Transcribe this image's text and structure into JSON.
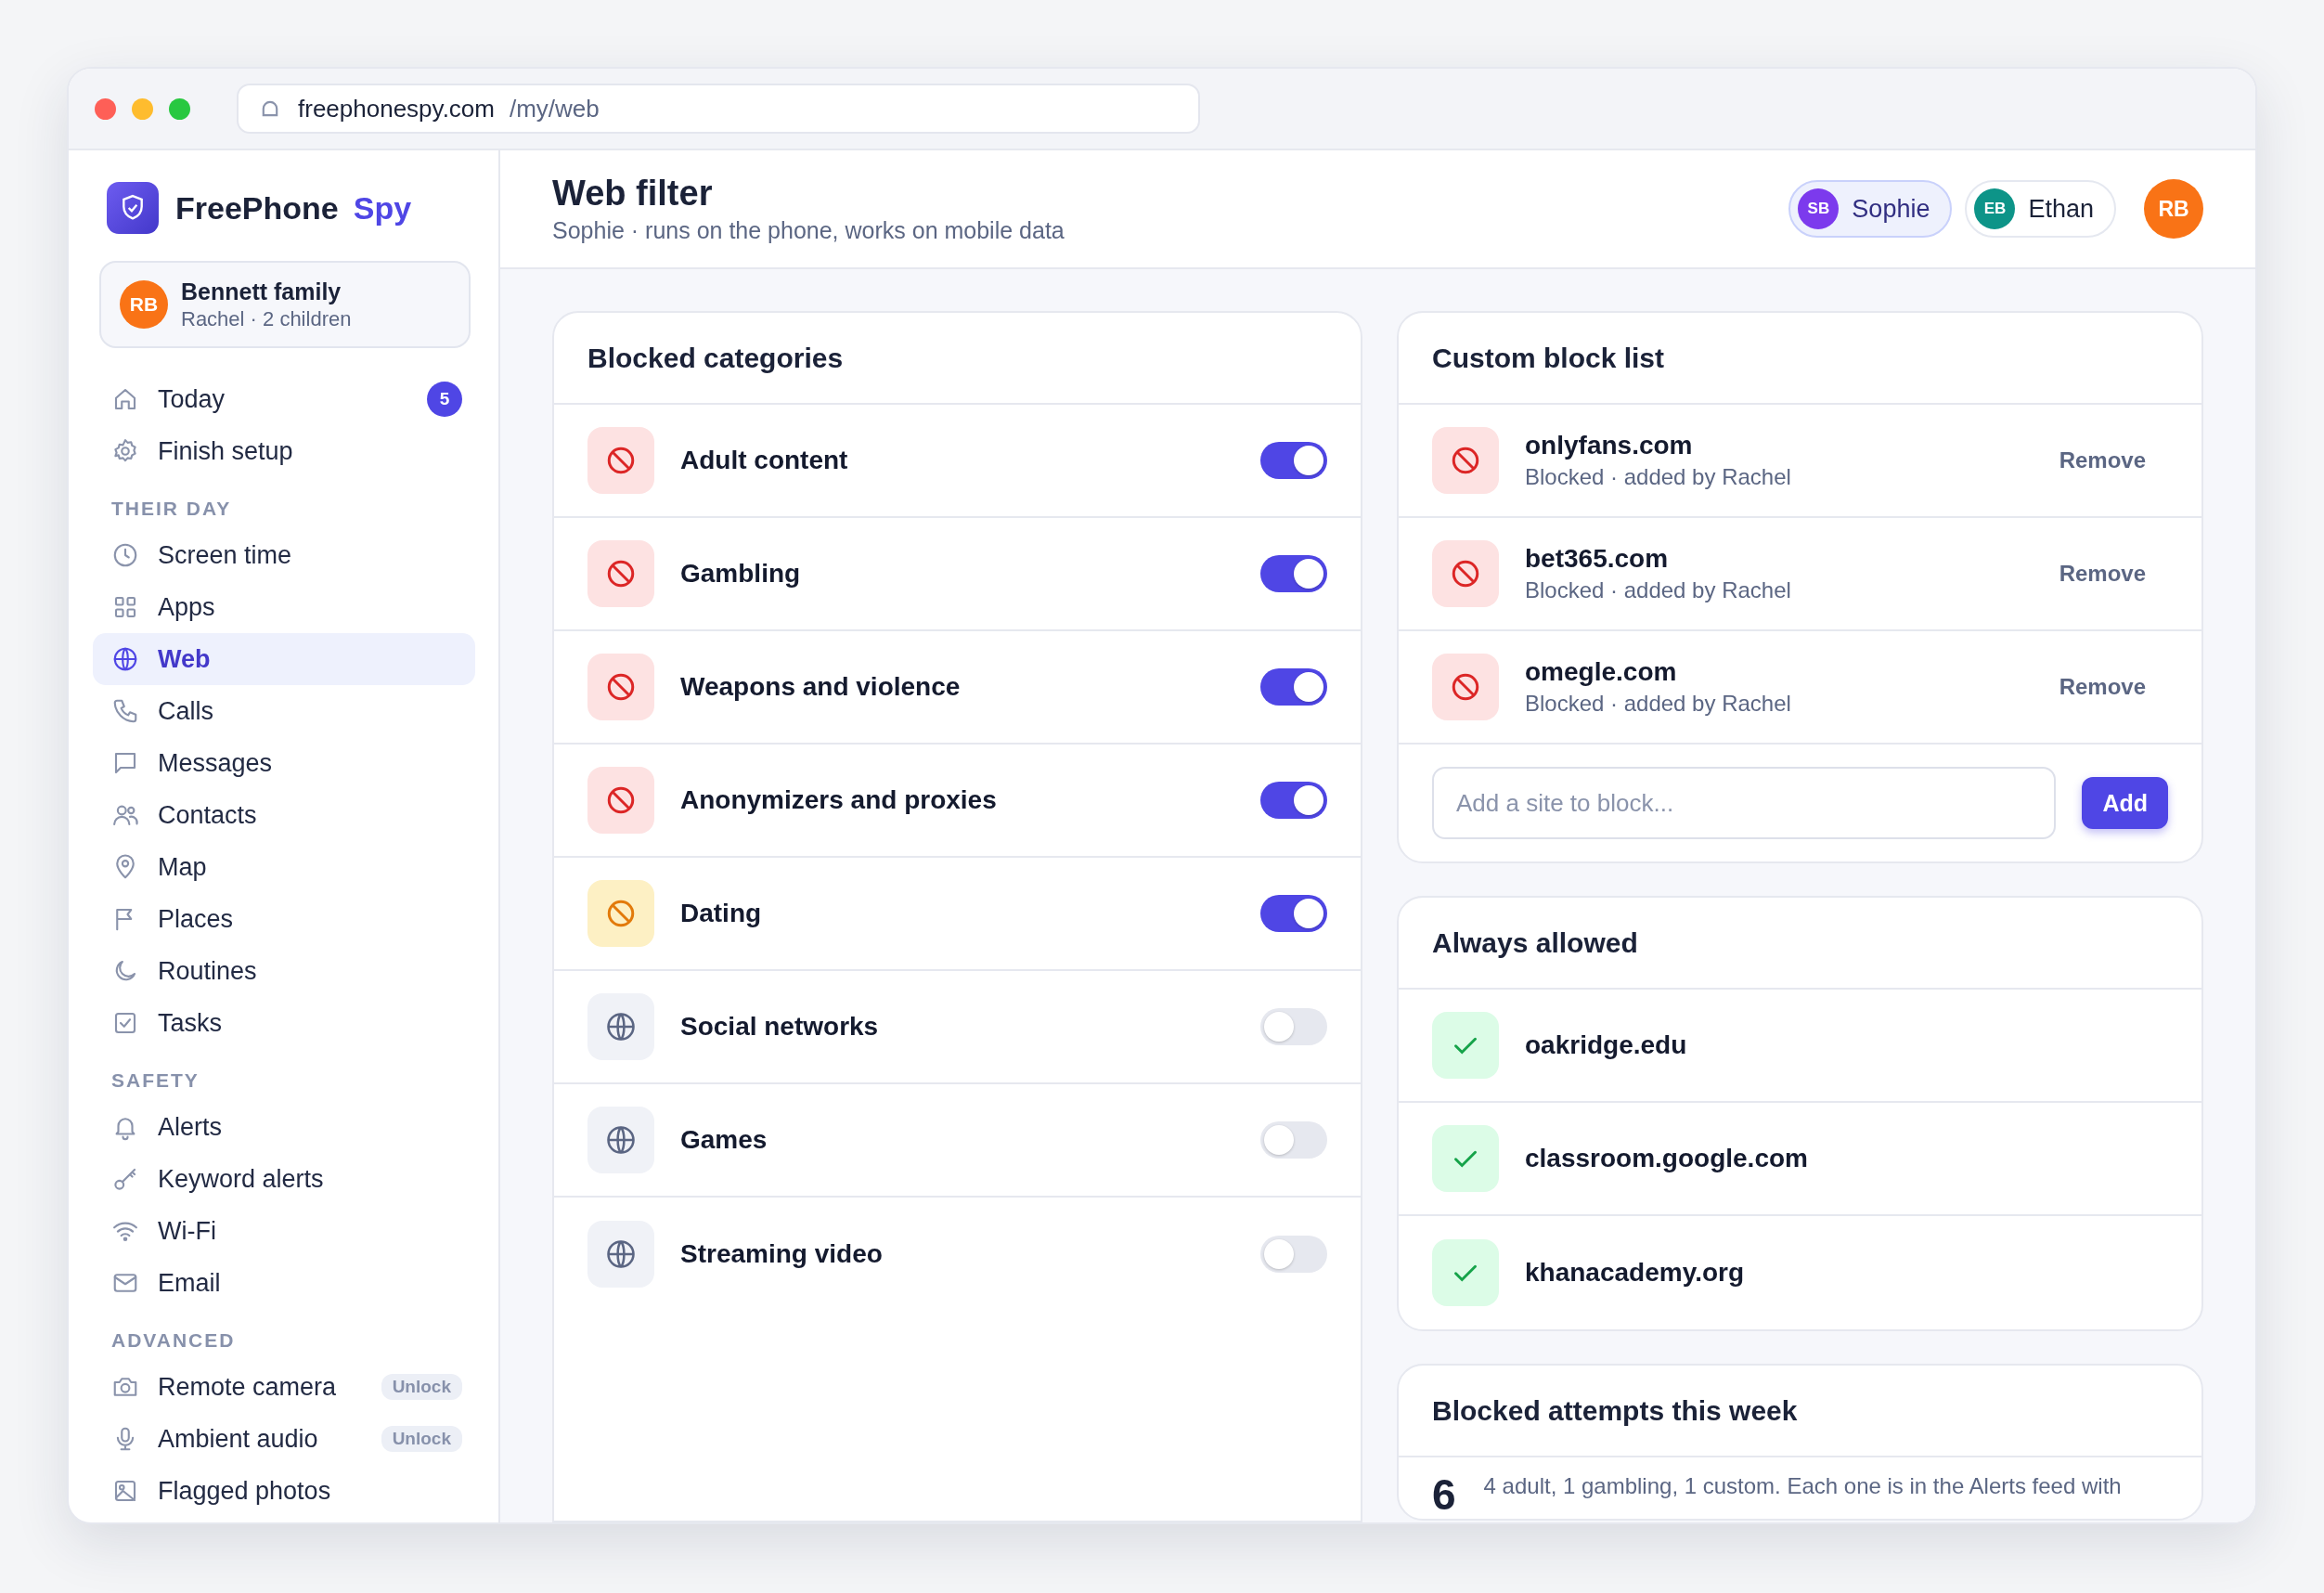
{
  "browser": {
    "domain": "freephonespy.com",
    "path": "/my/web"
  },
  "sidebar": {
    "brand": {
      "name": "FreePhone",
      "accent": "Spy"
    },
    "account": {
      "initials": "RB",
      "name": "Bennett family",
      "meta": "Rachel · 2 children"
    },
    "groups": [
      {
        "items": [
          {
            "label": "Today",
            "selected": false,
            "badge": "5"
          },
          {
            "label": "Finish setup",
            "selected": false
          }
        ]
      },
      {
        "heading": "THEIR DAY",
        "items": [
          {
            "label": "Screen time",
            "selected": false
          },
          {
            "label": "Apps",
            "selected": false
          },
          {
            "label": "Web",
            "selected": true
          },
          {
            "label": "Calls",
            "selected": false
          },
          {
            "label": "Messages",
            "selected": false
          },
          {
            "label": "Contacts",
            "selected": false
          },
          {
            "label": "Map",
            "selected": false
          },
          {
            "label": "Places",
            "selected": false
          },
          {
            "label": "Routines",
            "selected": false
          },
          {
            "label": "Tasks",
            "selected": false
          }
        ]
      },
      {
        "heading": "SAFETY",
        "items": [
          {
            "label": "Alerts",
            "selected": false
          },
          {
            "label": "Keyword alerts",
            "selected": false
          },
          {
            "label": "Wi-Fi",
            "selected": false
          },
          {
            "label": "Email",
            "selected": false
          }
        ]
      },
      {
        "heading": "ADVANCED",
        "items": [
          {
            "label": "Remote camera",
            "selected": false,
            "tag": "Unlock"
          },
          {
            "label": "Ambient audio",
            "selected": false,
            "tag": "Unlock"
          },
          {
            "label": "Flagged photos",
            "selected": false
          }
        ]
      }
    ]
  },
  "header": {
    "title": "Web filter",
    "subtitle": "Sophie · runs on the phone, works on mobile data",
    "profiles": [
      {
        "initials": "SB",
        "name": "Sophie",
        "selected": true,
        "color": "#7c3aed"
      },
      {
        "initials": "EB",
        "name": "Ethan",
        "selected": false,
        "color": "#0d9488"
      }
    ],
    "user": {
      "initials": "RB"
    }
  },
  "categories_card": {
    "title": "Blocked categories",
    "items": [
      {
        "label": "Adult content",
        "kind": "blocked",
        "on": true
      },
      {
        "label": "Gambling",
        "kind": "blocked",
        "on": true
      },
      {
        "label": "Weapons and violence",
        "kind": "blocked",
        "on": true
      },
      {
        "label": "Anonymizers and proxies",
        "kind": "blocked",
        "on": true
      },
      {
        "label": "Dating",
        "kind": "caution",
        "on": true
      },
      {
        "label": "Social networks",
        "kind": "neutral",
        "on": false
      },
      {
        "label": "Games",
        "kind": "neutral",
        "on": false
      },
      {
        "label": "Streaming video",
        "kind": "neutral",
        "on": false
      }
    ]
  },
  "custom_block_list": {
    "title": "Custom block list",
    "items": [
      {
        "domain": "onlyfans.com",
        "meta": "Blocked · added by Rachel",
        "action": "Remove"
      },
      {
        "domain": "bet365.com",
        "meta": "Blocked · added by Rachel",
        "action": "Remove"
      },
      {
        "domain": "omegle.com",
        "meta": "Blocked · added by Rachel",
        "action": "Remove"
      }
    ],
    "input": {
      "placeholder": "Add a site to block..."
    },
    "button": "Add"
  },
  "always_allowed": {
    "title": "Always allowed",
    "items": [
      {
        "domain": "oakridge.edu"
      },
      {
        "domain": "classroom.google.com"
      },
      {
        "domain": "khanacademy.org"
      }
    ]
  },
  "blocked_attempts": {
    "title": "Blocked attempts this week",
    "count": "6",
    "text": "4 adult, 1 gambling, 1 custom. Each one is in the Alerts feed with"
  }
}
